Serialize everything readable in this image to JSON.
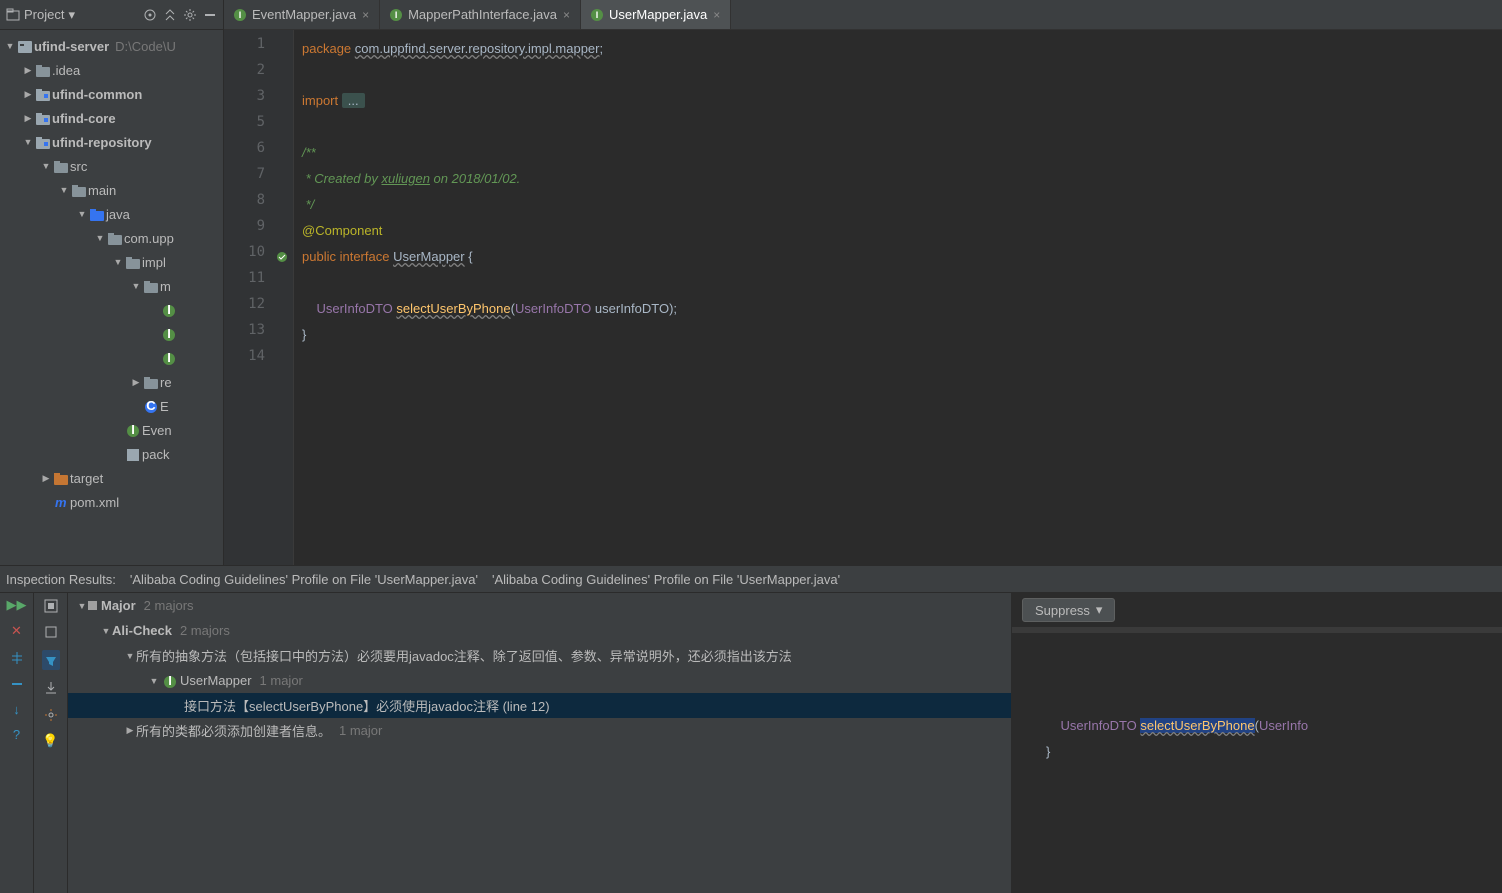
{
  "project": {
    "label": "Project",
    "root": {
      "name": "ufind-server",
      "path": "D:\\Code\\U"
    },
    "tree": [
      {
        "depth": 1,
        "arrow": "▶",
        "icon": "folder",
        "name": ".idea"
      },
      {
        "depth": 1,
        "arrow": "▶",
        "icon": "module",
        "name": "ufind-common",
        "bold": true
      },
      {
        "depth": 1,
        "arrow": "▶",
        "icon": "module",
        "name": "ufind-core",
        "bold": true
      },
      {
        "depth": 1,
        "arrow": "▼",
        "icon": "module",
        "name": "ufind-repository",
        "bold": true
      },
      {
        "depth": 2,
        "arrow": "▼",
        "icon": "folder",
        "name": "src"
      },
      {
        "depth": 3,
        "arrow": "▼",
        "icon": "folder",
        "name": "main"
      },
      {
        "depth": 4,
        "arrow": "▼",
        "icon": "src",
        "name": "java"
      },
      {
        "depth": 5,
        "arrow": "▼",
        "icon": "folder",
        "name": "com.upp"
      },
      {
        "depth": 6,
        "arrow": "▼",
        "icon": "folder",
        "name": "impl"
      },
      {
        "depth": 7,
        "arrow": "▼",
        "icon": "folder",
        "name": "m"
      },
      {
        "depth": 8,
        "arrow": "",
        "icon": "iface",
        "name": ""
      },
      {
        "depth": 8,
        "arrow": "",
        "icon": "iface",
        "name": ""
      },
      {
        "depth": 8,
        "arrow": "",
        "icon": "iface",
        "name": ""
      },
      {
        "depth": 7,
        "arrow": "▶",
        "icon": "folder",
        "name": "re"
      },
      {
        "depth": 7,
        "arrow": "",
        "icon": "class",
        "name": "E"
      },
      {
        "depth": 6,
        "arrow": "",
        "icon": "iface",
        "name": "Even"
      },
      {
        "depth": 6,
        "arrow": "",
        "icon": "pkg",
        "name": "pack"
      },
      {
        "depth": 2,
        "arrow": "▶",
        "icon": "target",
        "name": "target"
      },
      {
        "depth": 2,
        "arrow": "",
        "icon": "maven",
        "name": "pom.xml"
      }
    ]
  },
  "tabs": [
    {
      "name": "EventMapper.java",
      "active": false
    },
    {
      "name": "MapperPathInterface.java",
      "active": false
    },
    {
      "name": "UserMapper.java",
      "active": true
    }
  ],
  "code": {
    "lines": [
      "1",
      "2",
      "3",
      "5",
      "6",
      "7",
      "8",
      "9",
      "10",
      "11",
      "12",
      "13",
      "14"
    ]
  },
  "src": {
    "pkg_kw": "package",
    "pkg_name": "com.uppfind.server.repository.impl.mapper",
    "import_kw": "import",
    "import_rest": "...",
    "c1": "/**",
    "c2": " * Created by ",
    "c2_link": "xuliugen",
    "c2_rest": " on 2018/01/02.",
    "c3": " */",
    "ann": "@Component",
    "pub": "public",
    "iface": "interface",
    "ifname": "UserMapper",
    "brace_o": " {",
    "ret": "UserInfoDTO",
    "method": "selectUserByPhone",
    "param_t": "UserInfoDTO",
    "param_n": "userInfoDTO",
    "brace_c": "}"
  },
  "inspection": {
    "header": "Inspection Results:",
    "tab1": "'Alibaba Coding Guidelines' Profile on File 'UserMapper.java'",
    "tab2": "'Alibaba Coding Guidelines' Profile on File 'UserMapper.java'",
    "major": "Major",
    "major_cnt": "2 majors",
    "ali": "Ali-Check",
    "ali_cnt": "2 majors",
    "rule1": "所有的抽象方法（包括接口中的方法）必须要用javadoc注释、除了返回值、参数、异常说明外，还必须指出该方法",
    "file": "UserMapper",
    "file_cnt": "1 major",
    "issue": "接口方法【selectUserByPhone】必须使用javadoc注释 (line 12)",
    "rule2": "所有的类都必须添加创建者信息。",
    "rule2_cnt": "1 major",
    "suppress": "Suppress"
  },
  "preview": {
    "ret": "UserInfoDTO",
    "method": "selectUserByPhone",
    "param_t": "UserInfo",
    "brace": "}"
  }
}
